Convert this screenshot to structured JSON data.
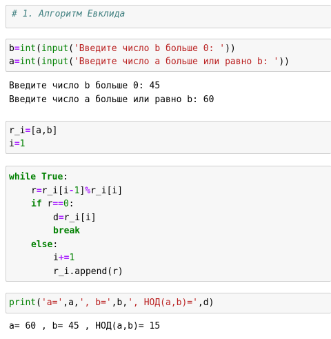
{
  "markdown_cell": {
    "text": "# 1. Алгоритм Евклида"
  },
  "cell_input": {
    "line1": {
      "var": "b",
      "eq": "=",
      "int": "int",
      "open1": "(",
      "input": "input",
      "open2": "(",
      "prompt": "'Введите число b больше 0: '",
      "close": "))"
    },
    "line2": {
      "var": "a",
      "eq": "=",
      "int": "int",
      "open1": "(",
      "input": "input",
      "open2": "(",
      "prompt": "'Введите число a больше или равно b: '",
      "close": "))"
    },
    "output": [
      "Введите число b больше 0: 45",
      "Введите число a больше или равно b: 60"
    ]
  },
  "cell_init": {
    "line1": {
      "left": "r_i",
      "eq": "=",
      "right": "[a,b]"
    },
    "line2": {
      "left": "i",
      "eq": "=",
      "num": "1"
    }
  },
  "cell_loop": {
    "l1": {
      "kw": "while",
      "sp": " ",
      "val": "True",
      "colon": ":"
    },
    "l2": {
      "a": "r",
      "eq": "=",
      "b": "r_i[i",
      "minus": "-",
      "one": "1",
      "c": "]",
      "mod": "%",
      "d": "r_i[i]"
    },
    "l3": {
      "kw": "if",
      "a": " r",
      "eq": "==",
      "zero": "0",
      "colon": ":"
    },
    "l4": {
      "a": "d",
      "eq": "=",
      "b": "r_i[i]"
    },
    "l5": {
      "kw": "break"
    },
    "l6": {
      "kw": "else",
      "colon": ":"
    },
    "l7": {
      "a": "i",
      "op": "+=",
      "num": "1"
    },
    "l8": {
      "a": "r_i.append(r)"
    }
  },
  "cell_print": {
    "fn": "print",
    "open": "(",
    "s1": "'a='",
    "p1": ",a,",
    "s2": "', b='",
    "p2": ",b,",
    "s3": "', НОД(a,b)='",
    "p3": ",d)",
    "output": "a= 60 , b= 45 , НОД(a,b)= 15"
  }
}
